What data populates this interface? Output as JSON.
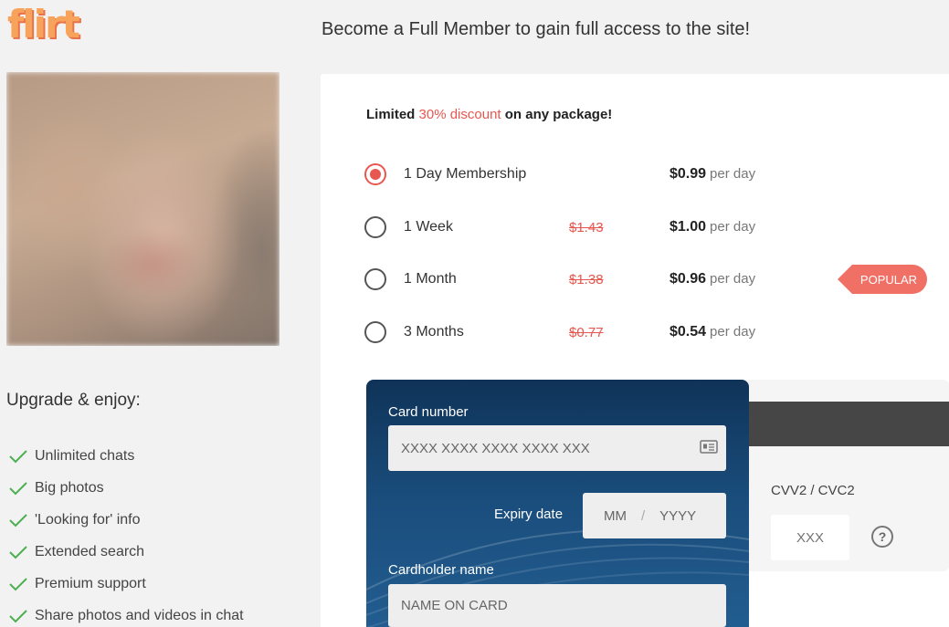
{
  "brand": {
    "logo_text": "flirt"
  },
  "header": {
    "headline": "Become a Full Member to gain full access to the site!"
  },
  "sidebar": {
    "upgrade_title": "Upgrade & enjoy:",
    "features": [
      "Unlimited chats",
      "Big photos",
      "'Looking for' info",
      "Extended search",
      "Premium support",
      "Share photos and videos in chat"
    ]
  },
  "offer": {
    "prefix": "Limited",
    "highlight": "30% discount",
    "suffix": "on any package!"
  },
  "plans": [
    {
      "name": "1 Day Membership",
      "old_price": "",
      "price": "$0.99",
      "per": "per day",
      "selected": true
    },
    {
      "name": "1 Week",
      "old_price": "$1.43",
      "price": "$1.00",
      "per": "per day",
      "selected": false
    },
    {
      "name": "1 Month",
      "old_price": "$1.38",
      "price": "$0.96",
      "per": "per day",
      "selected": false,
      "badge": "POPULAR"
    },
    {
      "name": "3 Months",
      "old_price": "$0.77",
      "price": "$0.54",
      "per": "per day",
      "selected": false
    }
  ],
  "payment": {
    "card_number_label": "Card number",
    "card_number_placeholder": "XXXX XXXX XXXX XXXX XXX",
    "expiry_label": "Expiry date",
    "expiry_month_placeholder": "MM",
    "expiry_separator": "/",
    "expiry_year_placeholder": "YYYY",
    "cardholder_label": "Cardholder name",
    "cardholder_placeholder": "NAME ON CARD",
    "cvv_label": "CVV2 / CVC2",
    "cvv_placeholder": "XXX",
    "help_symbol": "?"
  },
  "colors": {
    "accent": "#e8574f",
    "card_dark": "#0f3358",
    "card_light": "#235f93",
    "check": "#4caf50"
  },
  "icons": {
    "feature_check": "check-icon",
    "card_field": "id-card-icon",
    "help": "question-circle-icon"
  }
}
